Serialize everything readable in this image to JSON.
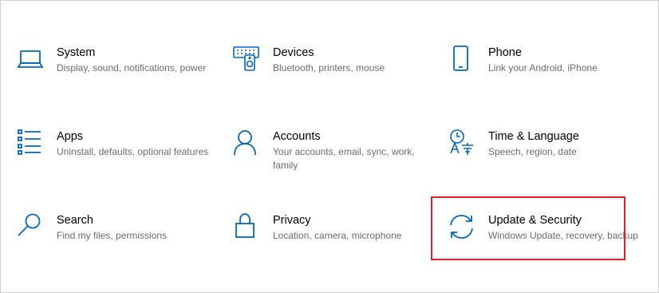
{
  "accent_color": "#0067c0",
  "highlight_color": "#d9222a",
  "tiles": [
    {
      "title": "System",
      "desc": "Display, sound, notifications, power",
      "icon": "laptop-icon"
    },
    {
      "title": "Devices",
      "desc": "Bluetooth, printers, mouse",
      "icon": "devices-icon"
    },
    {
      "title": "Phone",
      "desc": "Link your Android, iPhone",
      "icon": "phone-icon"
    },
    {
      "title": "Apps",
      "desc": "Uninstall, defaults, optional features",
      "icon": "apps-list-icon"
    },
    {
      "title": "Accounts",
      "desc": "Your accounts, email, sync, work, family",
      "icon": "person-icon"
    },
    {
      "title": "Time & Language",
      "desc": "Speech, region, date",
      "icon": "time-language-icon"
    },
    {
      "title": "Search",
      "desc": "Find my files, permissions",
      "icon": "search-icon"
    },
    {
      "title": "Privacy",
      "desc": "Location, camera, microphone",
      "icon": "lock-icon"
    },
    {
      "title": "Update & Security",
      "desc": "Windows Update, recovery, backup",
      "icon": "sync-icon"
    }
  ]
}
